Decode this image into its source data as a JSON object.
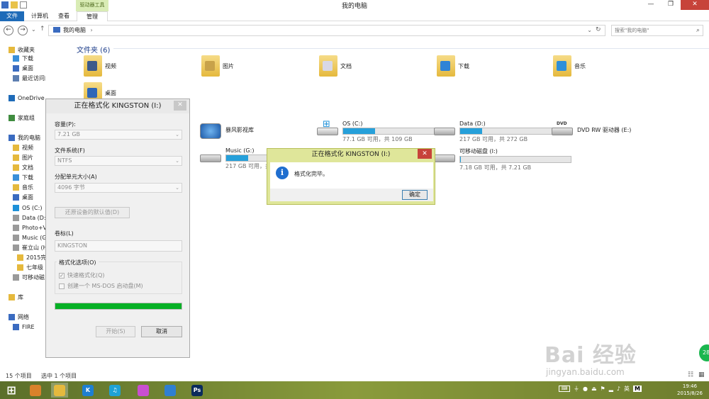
{
  "window": {
    "title": "我的电脑",
    "tool_tab": "驱动器工具",
    "tabs": [
      "文件",
      "计算机",
      "查看",
      "管理"
    ]
  },
  "address": {
    "path": "我的电脑",
    "separator": "›",
    "search_placeholder": "搜索\"我的电脑\""
  },
  "sidebar": {
    "items": [
      {
        "label": "收藏夹",
        "icon": "star-icon",
        "color": "#e5b93d"
      },
      {
        "label": "下载",
        "icon": "download-folder-icon",
        "color": "#3a8fd9"
      },
      {
        "label": "桌面",
        "icon": "desktop-icon",
        "color": "#3a6bc0"
      },
      {
        "label": "最近访问的位置",
        "icon": "recent-icon",
        "color": "#5d7fb1"
      },
      {
        "label": "OneDrive",
        "icon": "cloud-icon",
        "color": "#1e6bb8"
      },
      {
        "label": "家庭组",
        "icon": "homegroup-icon",
        "color": "#3f8c3f"
      },
      {
        "label": "我的电脑",
        "icon": "computer-icon",
        "color": "#3a6bc0"
      },
      {
        "label": "视频",
        "icon": "video-folder-icon",
        "color": "#e5b93d"
      },
      {
        "label": "图片",
        "icon": "pictures-folder-icon",
        "color": "#e5b93d"
      },
      {
        "label": "文档",
        "icon": "documents-folder-icon",
        "color": "#e5b93d"
      },
      {
        "label": "下载",
        "icon": "download-folder-icon",
        "color": "#3a8fd9"
      },
      {
        "label": "音乐",
        "icon": "music-folder-icon",
        "color": "#e5b93d"
      },
      {
        "label": "桌面",
        "icon": "desktop-icon",
        "color": "#3a6bc0"
      },
      {
        "label": "OS (C:)",
        "icon": "windows-drive-icon",
        "color": "#1e90d8"
      },
      {
        "label": "Data (D:)",
        "icon": "drive-icon",
        "color": "#9a9a9a"
      },
      {
        "label": "Photo+V",
        "icon": "drive-icon",
        "color": "#9a9a9a"
      },
      {
        "label": "Music (G",
        "icon": "drive-icon",
        "color": "#9a9a9a"
      },
      {
        "label": "崔立山 (H",
        "icon": "drive-icon",
        "color": "#9a9a9a"
      },
      {
        "label": "2015完",
        "icon": "folder-icon",
        "color": "#e5b93d"
      },
      {
        "label": "七年级",
        "icon": "folder-icon",
        "color": "#e5b93d"
      },
      {
        "label": "可移动磁",
        "icon": "removable-drive-icon",
        "color": "#9a9a9a"
      },
      {
        "label": "库",
        "icon": "library-icon",
        "color": "#e5b93d"
      },
      {
        "label": "网络",
        "icon": "network-icon",
        "color": "#3a6bc0"
      },
      {
        "label": "FIRE",
        "icon": "network-computer-icon",
        "color": "#3a6bc0"
      }
    ]
  },
  "folders": {
    "header": "文件夹 (6)",
    "items": [
      {
        "label": "视频",
        "overlay": "#3c5a8a"
      },
      {
        "label": "图片",
        "overlay": "#c8a24a"
      },
      {
        "label": "文档",
        "overlay": "#d8d8e6"
      },
      {
        "label": "下载",
        "overlay": "#2f83d6"
      },
      {
        "label": "音乐",
        "overlay": "#2f8fd9"
      },
      {
        "label": "桌面",
        "overlay": "#2d66b8"
      }
    ]
  },
  "drives": [
    {
      "label": "暴风影视库",
      "icon": "storm-library-icon",
      "used": null,
      "sub": ""
    },
    {
      "label": "OS (C:)",
      "icon": "windows-drive-icon",
      "used": 0.29,
      "sub": "77.1 GB 可用，共 109 GB"
    },
    {
      "label": "Data (D:)",
      "icon": "drive-icon",
      "used": 0.2,
      "sub": "217 GB 可用，共 272 GB"
    },
    {
      "label": "DVD RW 驱动器 (E:)",
      "icon": "dvd-drive-icon",
      "used": null,
      "sub": ""
    },
    {
      "label": "Music (G:)",
      "icon": "drive-icon",
      "used": 0.2,
      "sub": "217 GB 可用，共 272 GB"
    },
    {
      "label": "可移动磁盘 (I:)",
      "icon": "removable-drive-icon",
      "used": 0.005,
      "sub": "7.18 GB 可用，共 7.21 GB"
    }
  ],
  "status": {
    "count": "15 个项目",
    "selected": "选中 1 个项目"
  },
  "format_dialog": {
    "title": "正在格式化 KINGSTON (I:)",
    "capacity_label": "容量(P):",
    "capacity_value": "7.21 GB",
    "fs_label": "文件系统(F)",
    "fs_value": "NTFS",
    "alloc_label": "分配单元大小(A)",
    "alloc_value": "4096 字节",
    "restore_btn": "还原设备的默认值(D)",
    "volume_label": "卷标(L)",
    "volume_value": "KINGSTON",
    "options_label": "格式化选项(O)",
    "quick_format": "快速格式化(Q)",
    "create_msdos": "创建一个 MS-DOS 启动盘(M)",
    "progress": 1.0,
    "start_btn": "开始(S)",
    "cancel_btn": "取消"
  },
  "message_dialog": {
    "title": "正在格式化 KINGSTON (I:)",
    "text": "格式化完毕。",
    "ok": "确定"
  },
  "taskbar": {
    "apps": [
      {
        "name": "start-button",
        "glyph": "⊞",
        "color": "#ffffff"
      },
      {
        "name": "app-game-icon",
        "glyph": "",
        "color": "#d9822b"
      },
      {
        "name": "file-explorer-icon",
        "glyph": "",
        "color": "#e5b93d"
      },
      {
        "name": "kuaibo-icon",
        "glyph": "K",
        "color": "#1e7fd1"
      },
      {
        "name": "im-icon",
        "glyph": "♫",
        "color": "#1fa2d6"
      },
      {
        "name": "picasa-icon",
        "glyph": "",
        "color": "#c94fd1"
      },
      {
        "name": "app-bird-icon",
        "glyph": "",
        "color": "#2f7fd1"
      },
      {
        "name": "photoshop-icon",
        "glyph": "Ps",
        "color": "#0a2b5c"
      }
    ],
    "ime": "英",
    "time": "19:46",
    "date": "2015/8/26"
  },
  "watermark": {
    "text": "Bai 经验",
    "url": "jingyan.baidu.com"
  },
  "badge": "28"
}
